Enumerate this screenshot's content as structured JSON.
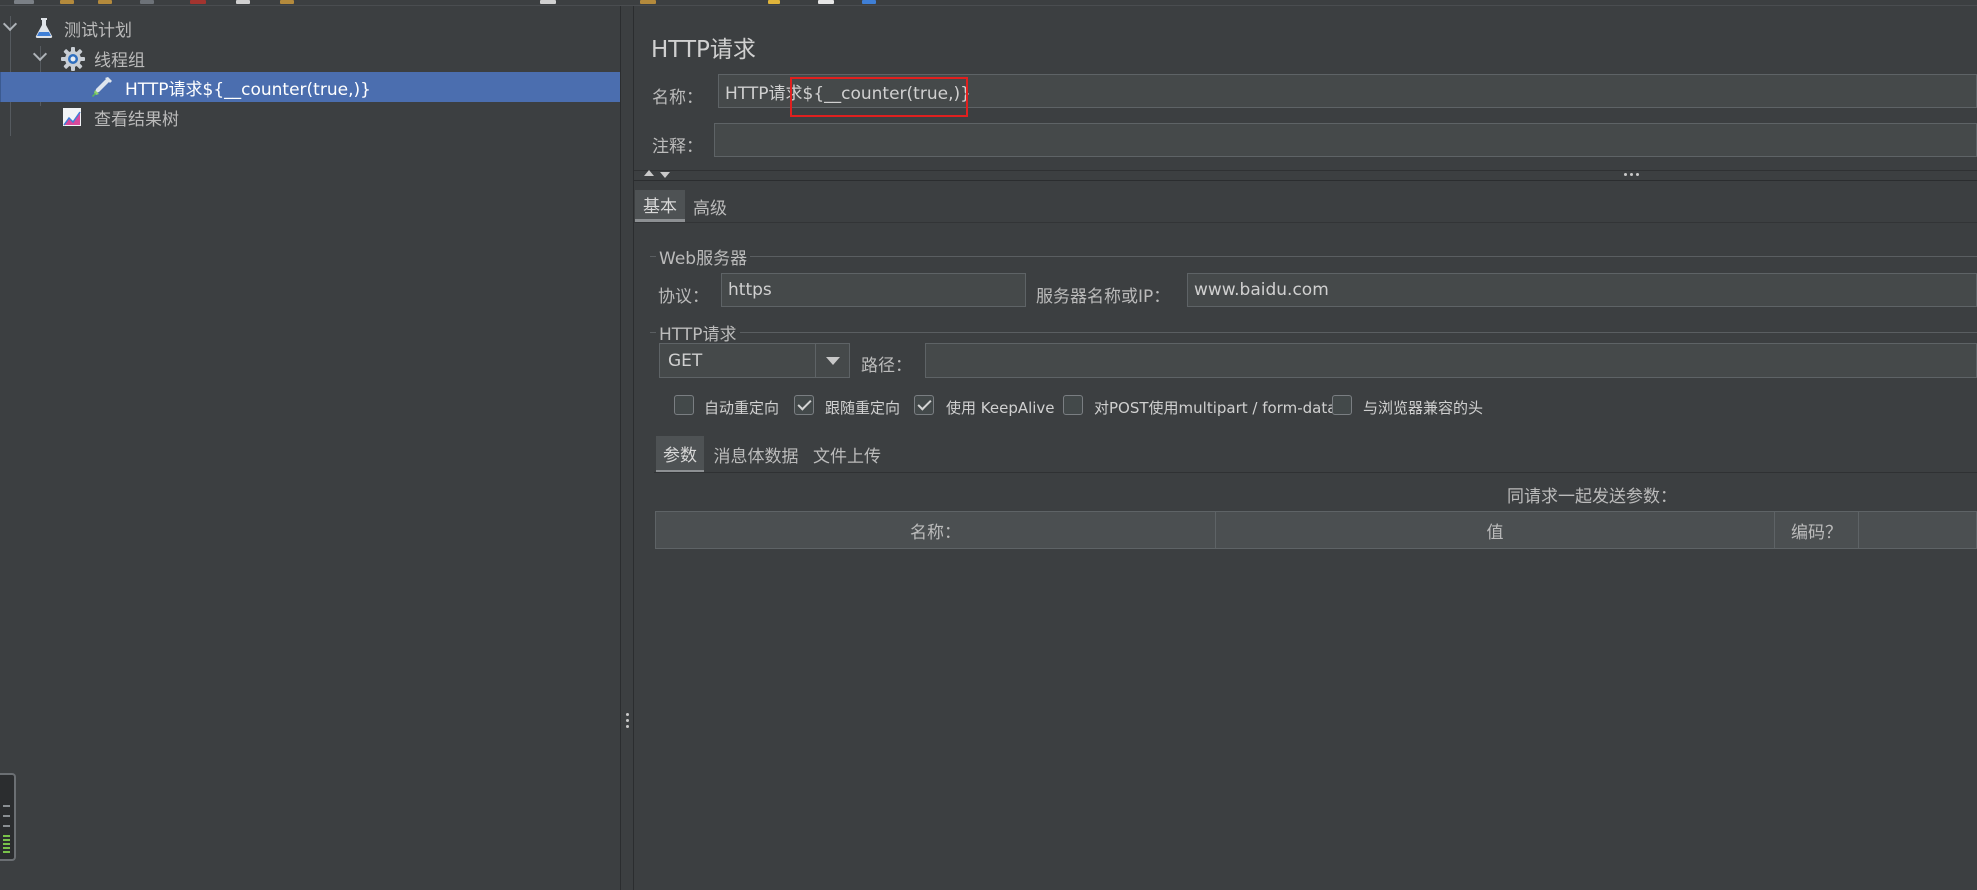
{
  "tree": {
    "items": [
      {
        "label": "测试计划",
        "icon": "test-plan-flask-icon",
        "expanded": true
      },
      {
        "label": "线程组",
        "icon": "thread-group-gear-icon",
        "expanded": true
      },
      {
        "label": "HTTP请求${__counter(true,)}",
        "icon": "http-sampler-pipette-icon",
        "selected": true
      },
      {
        "label": "查看结果树",
        "icon": "results-tree-chart-icon"
      }
    ]
  },
  "editor": {
    "title": "HTTP请求",
    "name_label": "名称：",
    "name_value": "HTTP请求${__counter(true,)}",
    "comment_label": "注释：",
    "comment_value": "",
    "tabs": [
      {
        "label": "基本",
        "active": true
      },
      {
        "label": "高级"
      }
    ],
    "web_server": {
      "section_title": "Web服务器",
      "protocol_label": "协议：",
      "protocol_value": "https",
      "server_label": "服务器名称或IP：",
      "server_value": "www.baidu.com"
    },
    "http_request": {
      "section_title": "HTTP请求",
      "method_value": "GET",
      "path_label": "路径：",
      "path_value": ""
    },
    "checkboxes": [
      {
        "label": "自动重定向",
        "checked": false
      },
      {
        "label": "跟随重定向",
        "checked": true
      },
      {
        "label": "使用 KeepAlive",
        "checked": true
      },
      {
        "label": "对POST使用multipart / form-data",
        "checked": false
      },
      {
        "label": "与浏览器兼容的头",
        "checked": false
      }
    ],
    "param_tabs": [
      {
        "label": "参数",
        "active": true
      },
      {
        "label": "消息体数据"
      },
      {
        "label": "文件上传"
      }
    ],
    "params_caption": "同请求一起发送参数：",
    "table_headers": [
      "名称：",
      "值",
      "编码？"
    ]
  },
  "colors": {
    "background": "#3c3f41",
    "selection": "#4b6eaf",
    "highlight_box": "#e0201f"
  }
}
